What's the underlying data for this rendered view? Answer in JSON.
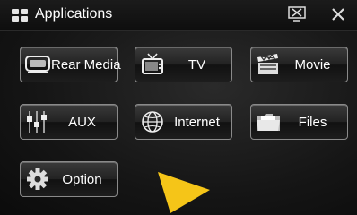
{
  "header": {
    "title": "Applications",
    "app_icon": "grid-icon",
    "display_icon": "display-close-icon",
    "close_icon": "close-icon"
  },
  "apps": [
    {
      "label": "Rear Media",
      "icon": "rear-media-icon"
    },
    {
      "label": "TV",
      "icon": "tv-icon"
    },
    {
      "label": "Movie",
      "icon": "movie-icon"
    },
    {
      "label": "AUX",
      "icon": "aux-icon"
    },
    {
      "label": "Internet",
      "icon": "internet-icon"
    },
    {
      "label": "Files",
      "icon": "files-icon"
    },
    {
      "label": "Option",
      "icon": "option-gear-icon"
    }
  ],
  "colors": {
    "pointer": "#F5C518",
    "button_border": "#8A8A8A"
  }
}
